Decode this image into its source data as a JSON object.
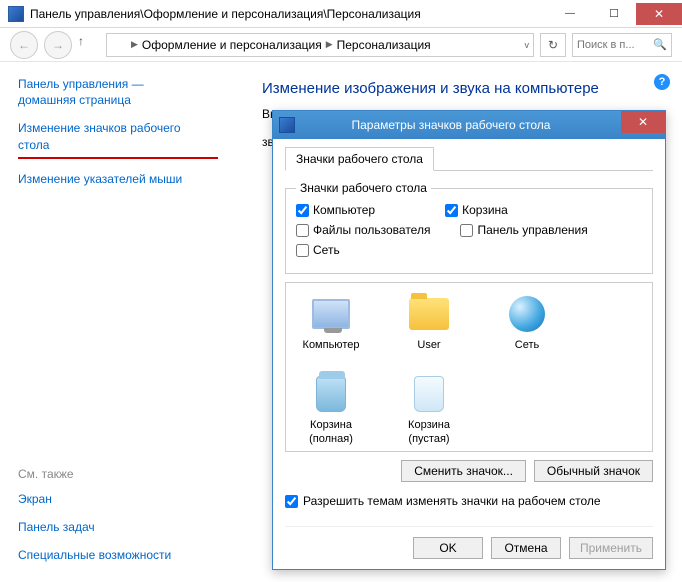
{
  "window": {
    "title": "Панель управления\\Оформление и персонализация\\Персонализация"
  },
  "breadcrumb": {
    "level1": "Оформление и персонализация",
    "level2": "Персонализация"
  },
  "search": {
    "placeholder": "Поиск в п..."
  },
  "sidebar": {
    "home1": "Панель управления —",
    "home2": "домашняя страница",
    "link_icons1": "Изменение значков рабочего",
    "link_icons2": "стола",
    "link_pointer": "Изменение указателей мыши",
    "see_also": "См. также",
    "screen": "Экран",
    "taskbar": "Панель задач",
    "access": "Специальные возможности"
  },
  "content": {
    "heading": "Изменение изображения и звука на компьютере",
    "cutoff1": "Вь",
    "cutoff2": "зв"
  },
  "dialog": {
    "title": "Параметры значков рабочего стола",
    "tab": "Значки рабочего стола",
    "group_legend": "Значки рабочего стола",
    "chk_computer": "Компьютер",
    "chk_recycle": "Корзина",
    "chk_userfiles": "Файлы пользователя",
    "chk_cpl": "Панель управления",
    "chk_network": "Сеть",
    "icons": {
      "computer": "Компьютер",
      "user": "User",
      "network": "Сеть",
      "bin_full1": "Корзина",
      "bin_full2": "(полная)",
      "bin_empty1": "Корзина",
      "bin_empty2": "(пустая)"
    },
    "btn_change": "Сменить значок...",
    "btn_default": "Обычный значок",
    "allow_themes": "Разрешить темам изменять значки на рабочем столе",
    "ok": "OK",
    "cancel": "Отмена",
    "apply": "Применить"
  },
  "checked": {
    "computer": true,
    "recycle": true,
    "userfiles": false,
    "cpl": false,
    "network": false,
    "allow": true
  }
}
